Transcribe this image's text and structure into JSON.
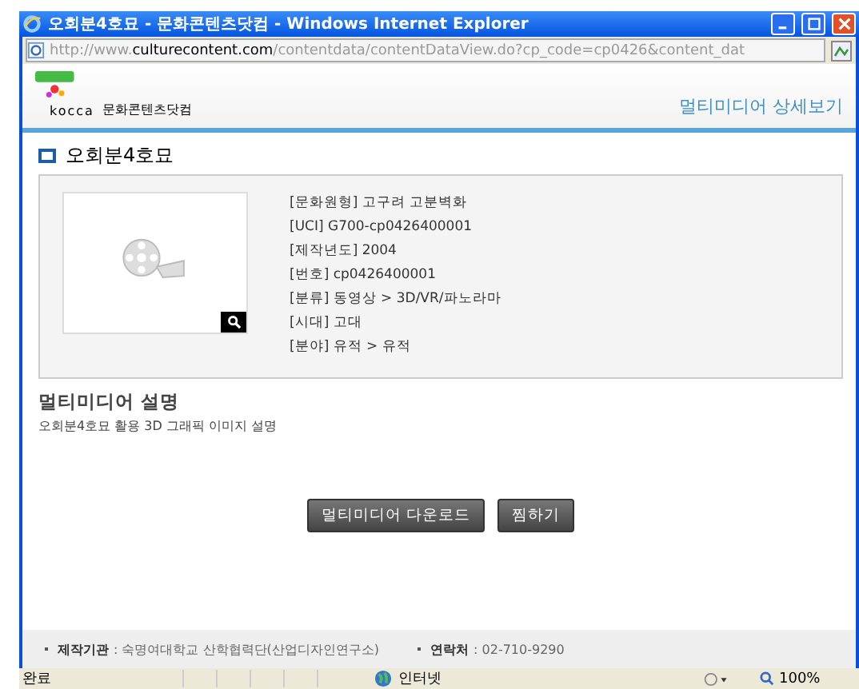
{
  "window": {
    "title": "오회분4호묘 - 문화콘텐츠닷컴 - Windows Internet Explorer"
  },
  "address_bar": {
    "prefix": "http://www.",
    "domain": "culturecontent.com",
    "path": "/contentdata/contentDataView.do?cp_code=cp0426&content_dat"
  },
  "header": {
    "logo_text": "kocca",
    "site_name": "문화콘텐츠닷컴",
    "page_title": "멀티미디어 상세보기"
  },
  "item": {
    "title": "오회분4호묘",
    "details": [
      "[문화원형] 고구려 고분벽화",
      "[UCI] G700-cp0426400001",
      "[제작년도] 2004",
      "[번호] cp0426400001",
      "[분류] 동영상 > 3D/VR/파노라마",
      "[시대] 고대",
      "[분야] 유적 > 유적"
    ]
  },
  "description": {
    "heading": "멀티미디어 설명",
    "text": "오회분4호묘 활용 3D 그래픽 이미지 설명"
  },
  "buttons": [
    "멀티미디어 다운로드",
    "찜하기"
  ],
  "footer": [
    {
      "label": "제작기관",
      "value": ": 숙명여대학교 산학협력단(산업디자인연구소)"
    },
    {
      "label": "연락처",
      "value": ": 02-710-9290"
    }
  ],
  "status_bar": {
    "status": "완료",
    "zone": "인터넷",
    "zoom": "100%"
  }
}
